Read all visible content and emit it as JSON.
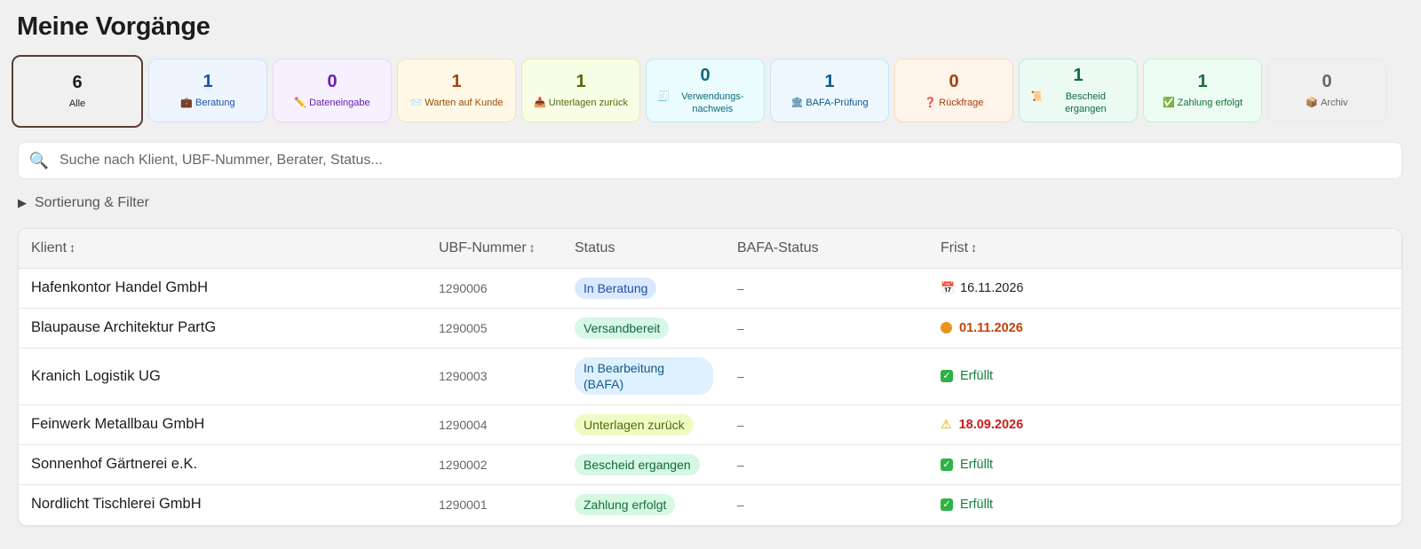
{
  "page_title": "Meine Vorgänge",
  "cards": [
    {
      "count": "6",
      "label": "Alle",
      "icon": "",
      "icon_name": "",
      "bg": "#f0f0f0",
      "border": "#5a3e36",
      "color": "#1c1c1c",
      "active": true
    },
    {
      "count": "1",
      "label": "Beratung",
      "icon": "💼",
      "icon_name": "briefcase-icon",
      "bg": "#eef5ff",
      "border": "#cfe1fb",
      "color": "#1e4fa8",
      "active": false
    },
    {
      "count": "0",
      "label": "Dateneingabe",
      "icon": "✏️",
      "icon_name": "pencil-icon",
      "bg": "#f7f0ff",
      "border": "#e6d7fb",
      "color": "#6a1fb0",
      "active": false
    },
    {
      "count": "1",
      "label": "Warten auf Kunde",
      "icon": "📨",
      "icon_name": "inbox-icon",
      "bg": "#fff8e6",
      "border": "#f6e2a9",
      "color": "#9a4a0c",
      "active": false
    },
    {
      "count": "1",
      "label": "Unterlagen zurück",
      "icon": "📥",
      "icon_name": "inbox-tray-icon",
      "bg": "#f8fde6",
      "border": "#e2f0a8",
      "color": "#4f6b0c",
      "active": false
    },
    {
      "count": "0",
      "label": "Verwendungs-nachweis",
      "icon": "🧾",
      "icon_name": "receipt-icon",
      "bg": "#eafcfd",
      "border": "#b9ecf2",
      "color": "#0e6a7a",
      "active": false
    },
    {
      "count": "1",
      "label": "BAFA-Prüfung",
      "icon": "🏛",
      "icon_name": "bank-icon",
      "bg": "#edf7fd",
      "border": "#c7e4f6",
      "color": "#0e5a8a",
      "active": false
    },
    {
      "count": "0",
      "label": "Rückfrage",
      "icon": "❓",
      "icon_name": "question-icon",
      "bg": "#fff4ea",
      "border": "#f7d9bd",
      "color": "#a1410d",
      "active": false
    },
    {
      "count": "1",
      "label": "Bescheid ergangen",
      "icon": "📜",
      "icon_name": "scroll-icon",
      "bg": "#ebfbf3",
      "border": "#bdebd5",
      "color": "#0f6a46",
      "active": false
    },
    {
      "count": "1",
      "label": "Zahlung erfolgt",
      "icon": "✅",
      "icon_name": "check-icon",
      "bg": "#edfcf2",
      "border": "#c3efd2",
      "color": "#13703a",
      "active": false
    },
    {
      "count": "0",
      "label": "Archiv",
      "icon": "📦",
      "icon_name": "box-icon",
      "bg": "#f0f0f0",
      "border": "#e8e8e8",
      "color": "#666666",
      "active": false
    }
  ],
  "search": {
    "placeholder": "Suche nach Klient, UBF-Nummer, Berater, Status..."
  },
  "filter_toggle": {
    "label": "Sortierung & Filter"
  },
  "table": {
    "headers": {
      "client": "Klient",
      "ubf": "UBF-Nummer",
      "status": "Status",
      "bafa": "BAFA-Status",
      "frist": "Frist"
    },
    "rows": [
      {
        "client": "Hafenkontor Handel GmbH",
        "ubf": "1290006",
        "status": "In Beratung",
        "status_bg": "#dbe9fe",
        "status_color": "#1e4fa8",
        "bafa": "–",
        "frist": "16.11.2026",
        "frist_icon": "calendar-icon",
        "frist_color": "#222222",
        "frist_weight": "normal"
      },
      {
        "client": "Blaupause Architektur PartG",
        "ubf": "1290005",
        "status": "Versandbereit",
        "status_bg": "#d7f8e6",
        "status_color": "#10683f",
        "bafa": "–",
        "frist": "01.11.2026",
        "frist_icon": "orange-dot-icon",
        "frist_color": "#c2410c",
        "frist_weight": "bold"
      },
      {
        "client": "Kranich Logistik UG",
        "ubf": "1290003",
        "status": "In Bearbeitung (BAFA)",
        "status_bg": "#dff0fe",
        "status_color": "#0e5a8a",
        "bafa": "–",
        "frist": "Erfüllt",
        "frist_icon": "check-icon",
        "frist_color": "#13803f",
        "frist_weight": "normal"
      },
      {
        "client": "Feinwerk Metallbau GmbH",
        "ubf": "1290004",
        "status": "Unterlagen zurück",
        "status_bg": "#eefcc4",
        "status_color": "#4f6b0c",
        "bafa": "–",
        "frist": "18.09.2026",
        "frist_icon": "warning-icon",
        "frist_color": "#c81e1e",
        "frist_weight": "bold"
      },
      {
        "client": "Sonnenhof Gärtnerei e.K.",
        "ubf": "1290002",
        "status": "Bescheid ergangen",
        "status_bg": "#d5f7e4",
        "status_color": "#10683f",
        "bafa": "–",
        "frist": "Erfüllt",
        "frist_icon": "check-icon",
        "frist_color": "#13803f",
        "frist_weight": "normal"
      },
      {
        "client": "Nordlicht Tischlerei GmbH",
        "ubf": "1290001",
        "status": "Zahlung erfolgt",
        "status_bg": "#d7f8e2",
        "status_color": "#13703a",
        "bafa": "–",
        "frist": "Erfüllt",
        "frist_icon": "check-icon",
        "frist_color": "#13803f",
        "frist_weight": "normal"
      }
    ]
  }
}
